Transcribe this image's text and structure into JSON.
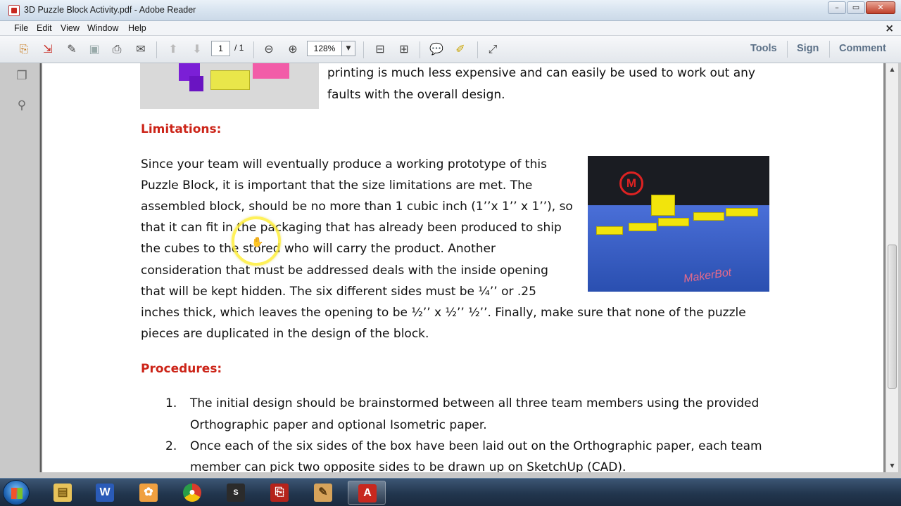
{
  "window": {
    "title": "3D Puzzle Block Activity.pdf - Adobe Reader"
  },
  "menubar": {
    "items": [
      "File",
      "Edit",
      "View",
      "Window",
      "Help"
    ],
    "close_glyph": "×"
  },
  "toolbar": {
    "page_current": "1",
    "page_total": "/ 1",
    "zoom": "128%",
    "links": [
      "Tools",
      "Sign",
      "Comment"
    ]
  },
  "document": {
    "intro_lines": [
      "printing is much less expensive and can easily be used to work out any",
      "faults with the overall design."
    ],
    "limitations_heading": "Limitations:",
    "limitations_lines": [
      "Since your team will eventually produce a working prototype of this",
      "Puzzle Block, it is important that the size limitations are met. The",
      "assembled block, should be no more than 1 cubic inch (1’’x 1’’ x 1’’), so",
      "that it can fit in the packaging that has already been produced to ship",
      "the cubes to the stored who will carry the product. Another",
      "consideration that must be addressed deals with the inside opening",
      "that will be kept hidden. The six different sides must be ¼’’ or .25",
      "inches thick, which leaves the opening to be ½’’ x ½’’ ½’’. Finally, make sure that none of the puzzle",
      "pieces are duplicated in the design of the block."
    ],
    "procedures_heading": "Procedures:",
    "procedures": [
      {
        "num": "1.",
        "lines": [
          "The initial design should be brainstormed between all three team members using the provided",
          "Orthographic paper and optional Isometric paper."
        ]
      },
      {
        "num": "2.",
        "lines": [
          "Once each of the six sides of the box have been laid out on the Orthographic paper, each team",
          "member can pick two opposite sides to be drawn up on SketchUp (CAD)."
        ]
      }
    ],
    "photo_brand": "MakerBot",
    "photo_logo_letter": "M"
  },
  "colors": {
    "heading": "#cc2418",
    "toolbar_link": "#5a6f86"
  },
  "icons": {
    "toolbar": [
      "create-pdf-icon",
      "export-icon",
      "edit-icon",
      "save-icon",
      "print-icon",
      "email-icon",
      "prev-page-icon",
      "next-page-icon",
      "zoom-out-icon",
      "zoom-in-icon",
      "fit-page-icon",
      "fit-width-icon",
      "comment-icon",
      "highlight-icon",
      "fullscreen-icon"
    ],
    "taskbar": [
      "explorer-icon",
      "word-icon",
      "paint-icon",
      "chrome-icon",
      "snagit-icon",
      "acrobat-icon",
      "sketch-icon",
      "adobe-reader-icon"
    ]
  }
}
